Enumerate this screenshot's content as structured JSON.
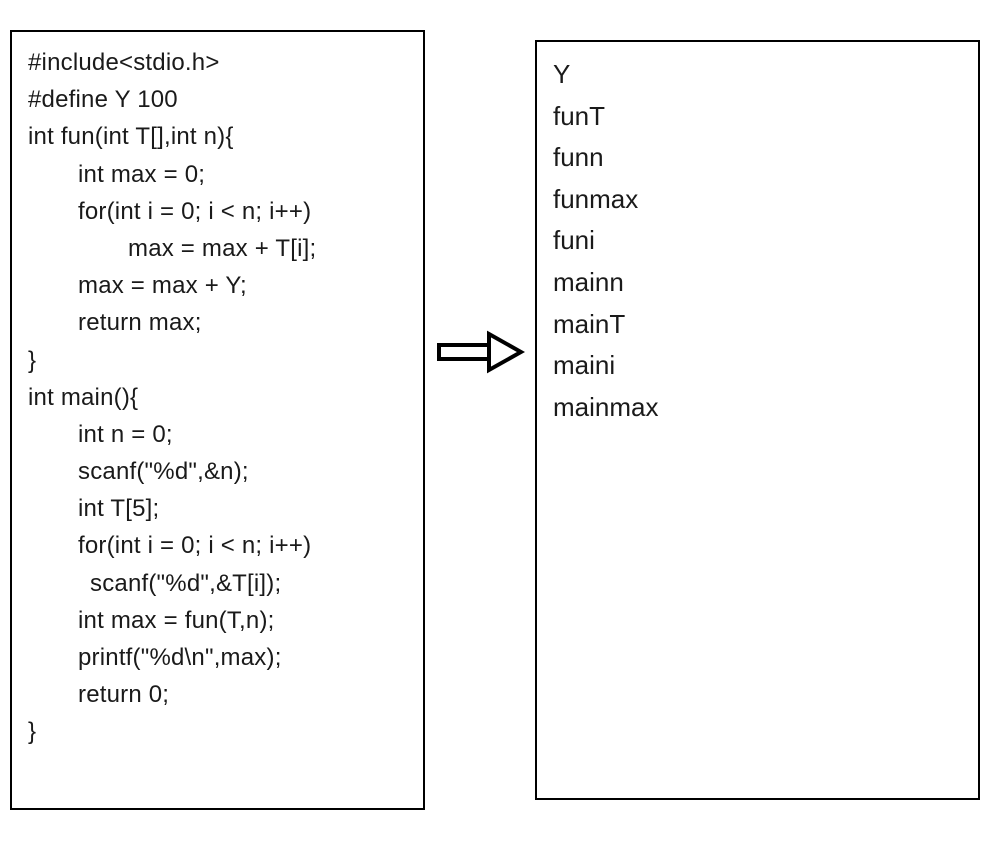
{
  "left": {
    "lines": [
      {
        "text": "#include<stdio.h>",
        "cls": ""
      },
      {
        "text": "#define Y 100",
        "cls": ""
      },
      {
        "text": "int fun(int T[],int n){",
        "cls": ""
      },
      {
        "text": "int max = 0;",
        "cls": "indent1"
      },
      {
        "text": "for(int i = 0; i < n; i++)",
        "cls": "indent1"
      },
      {
        "text": "max = max + T[i];",
        "cls": "indent2"
      },
      {
        "text": "max = max + Y;",
        "cls": "indent1"
      },
      {
        "text": "return max;",
        "cls": "indent1"
      },
      {
        "text": "}",
        "cls": ""
      },
      {
        "text": "int main(){",
        "cls": ""
      },
      {
        "text": "int n = 0;",
        "cls": "indent1"
      },
      {
        "text": "scanf(\"%d\",&n);",
        "cls": "indent1"
      },
      {
        "text": "int T[5];",
        "cls": "indent1"
      },
      {
        "text": "for(int i = 0; i < n; i++)",
        "cls": "indent1"
      },
      {
        "text": "scanf(\"%d\",&T[i]);",
        "cls": "indent1b"
      },
      {
        "text": "int max = fun(T,n);",
        "cls": "indent1"
      },
      {
        "text": "printf(\"%d\\n\",max);",
        "cls": "indent1"
      },
      {
        "text": "return 0;",
        "cls": "indent1"
      },
      {
        "text": "}",
        "cls": ""
      }
    ]
  },
  "right": {
    "lines": [
      "Y",
      "funT",
      "funn",
      "funmax",
      "funi",
      "mainn",
      "mainT",
      "maini",
      "mainmax"
    ]
  }
}
